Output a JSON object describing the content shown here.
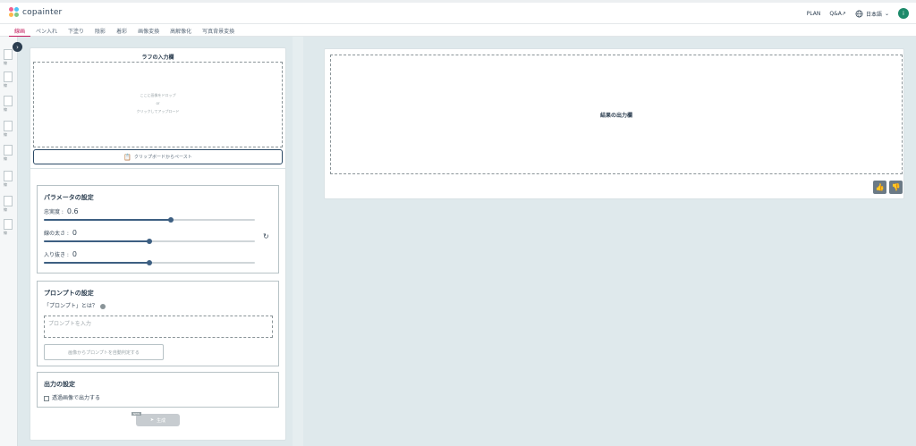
{
  "app": {
    "logo_text": "copainter"
  },
  "header": {
    "plan": "PLAN",
    "qa": "Q&A",
    "qa_icon": "external-link-icon",
    "language": "日本語",
    "avatar_letter": "i"
  },
  "tabs": [
    {
      "label": "線画",
      "active": true
    },
    {
      "label": "ペン入れ"
    },
    {
      "label": "下塗り"
    },
    {
      "label": "陰影"
    },
    {
      "label": "着彩"
    },
    {
      "label": "画像変換"
    },
    {
      "label": "高解像化"
    },
    {
      "label": "写真背景変換"
    }
  ],
  "sidebar": {
    "items": [
      "線",
      "線",
      "線",
      "線",
      "線",
      "線",
      "線",
      "線",
      "線",
      "線"
    ]
  },
  "input": {
    "title": "ラフの入力欄",
    "drop_line1": "ここに画像をドロップ",
    "drop_line2": "or",
    "drop_line3": "クリックしてアップロード",
    "paste_label": "クリップボードからペースト"
  },
  "params": {
    "title": "パラメータの設定",
    "sliders": [
      {
        "label": "忠実度",
        "value": "0.6",
        "fraction": 0.6
      },
      {
        "label": "線の太さ",
        "value": "0",
        "fraction": 0.5
      },
      {
        "label": "入り抜き",
        "value": "0",
        "fraction": 0.5
      }
    ]
  },
  "prompt": {
    "title": "プロンプトの設定",
    "question": "「プロンプト」とは？",
    "placeholder": "プロンプトを入力",
    "auto_label": "画像からプロンプトを自動判定する"
  },
  "output_settings": {
    "title": "出力の設定",
    "transparent_label": "透過画像で出力する",
    "transparent_checked": false
  },
  "generate": {
    "label": "生成",
    "badge": "NEW"
  },
  "result": {
    "title": "結果の出力欄"
  },
  "colors": {
    "accent": "#c2185b",
    "primary": "#3d5f82",
    "avatar": "#1d8a6a"
  }
}
